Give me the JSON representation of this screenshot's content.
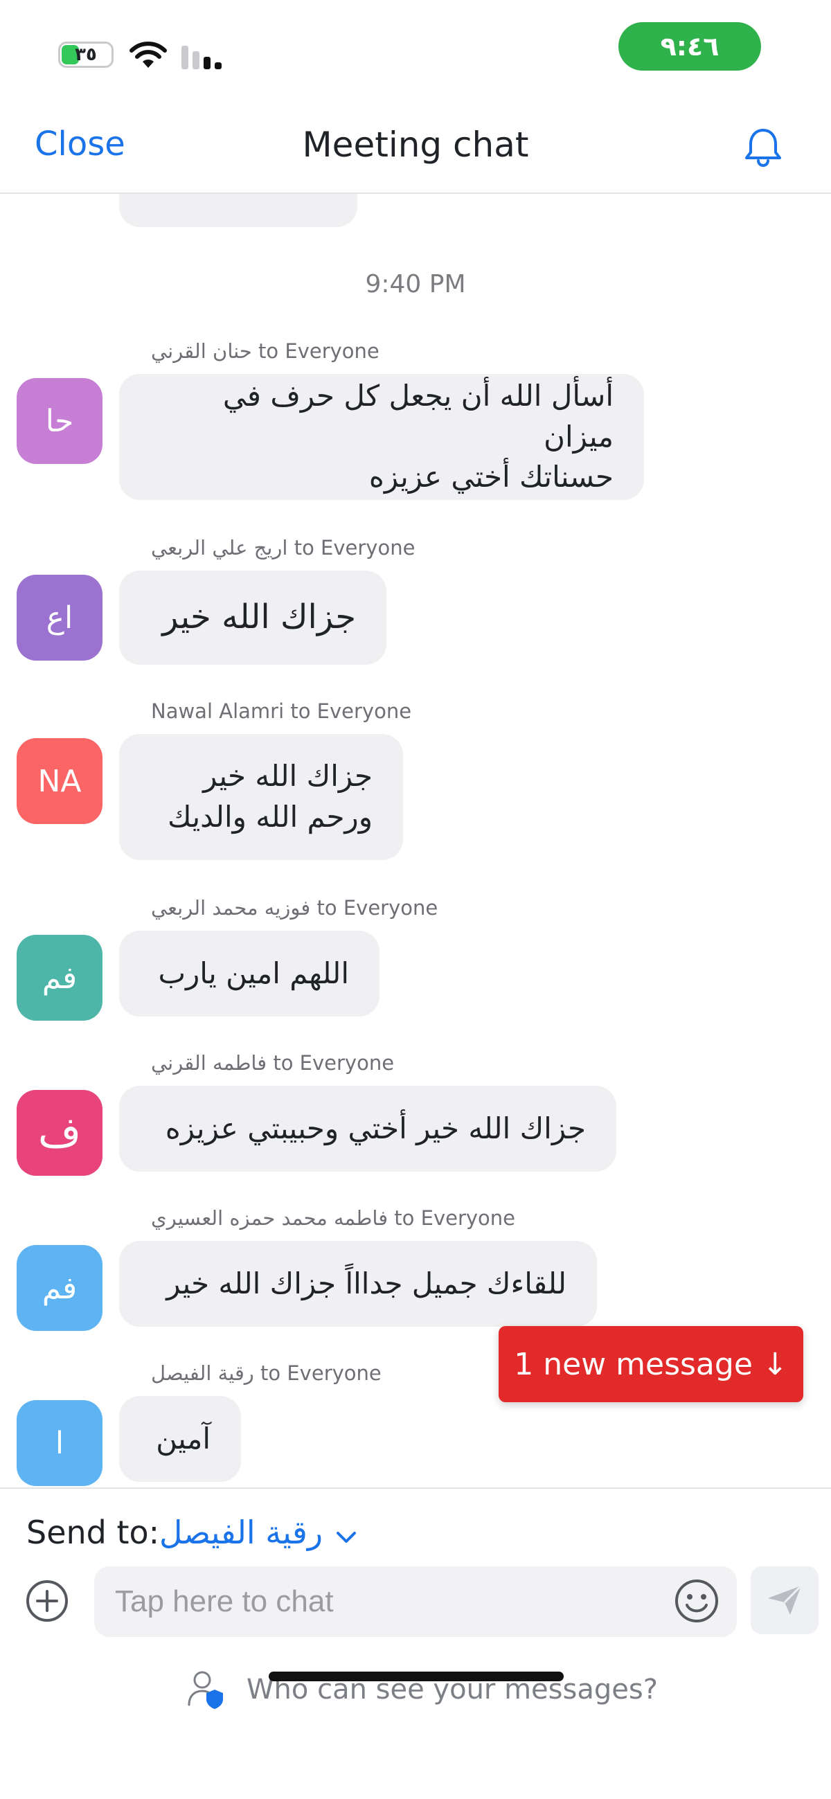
{
  "status_bar": {
    "time": "٩:٤٦",
    "battery": "٣٥"
  },
  "header": {
    "close_label": "Close",
    "title": "Meeting chat"
  },
  "chat": {
    "time_separator": "9:40 PM",
    "messages": [
      {
        "sender": "حنان القرني to Everyone",
        "avatar": "حا",
        "avatar_color": "#c77fd6",
        "text": "أسأل الله أن يجعل كل حرف في ميزان\nحسناتك أختي عزيزه"
      },
      {
        "sender": "اريج  علي الربعي to Everyone",
        "avatar": "اع",
        "avatar_color": "#9b72cf",
        "text": "جزاك الله خير"
      },
      {
        "sender": "Nawal Alamri to Everyone",
        "avatar": "NA",
        "avatar_color": "#fb6565",
        "text": "جزاك الله خير\nورحم الله والديك"
      },
      {
        "sender": "فوزيه محمد الربعي to Everyone",
        "avatar": "فم",
        "avatar_color": "#4db6a8",
        "text": "اللهم امين يارب"
      },
      {
        "sender": "فاطمه القرني to Everyone",
        "avatar": "ف",
        "avatar_color": "#e8437a",
        "text": "جزاك الله خير أختي  وحبيبتي عزيزه"
      },
      {
        "sender": "فاطمه محمد حمزه العسيري to Everyone",
        "avatar": "فم",
        "avatar_color": "#5eb3f3",
        "text": "للقاءك جميل جداااً جزاك الله خير"
      },
      {
        "sender": "رقية الفيصل to Everyone",
        "avatar": "ا",
        "avatar_color": "#5eb3f3",
        "text": "آمين"
      }
    ]
  },
  "new_message_label": "1 new message ↓",
  "composer": {
    "send_to_label": "Send to:",
    "send_to_value": "رقية الفيصل",
    "placeholder": "Tap here to chat",
    "privacy_text": "Who can see your messages?"
  },
  "icons": {
    "bell": "bell-icon",
    "plus": "plus-circle-icon",
    "emoji": "emoji-icon",
    "send": "send-icon",
    "privacy": "user-shield-icon"
  }
}
